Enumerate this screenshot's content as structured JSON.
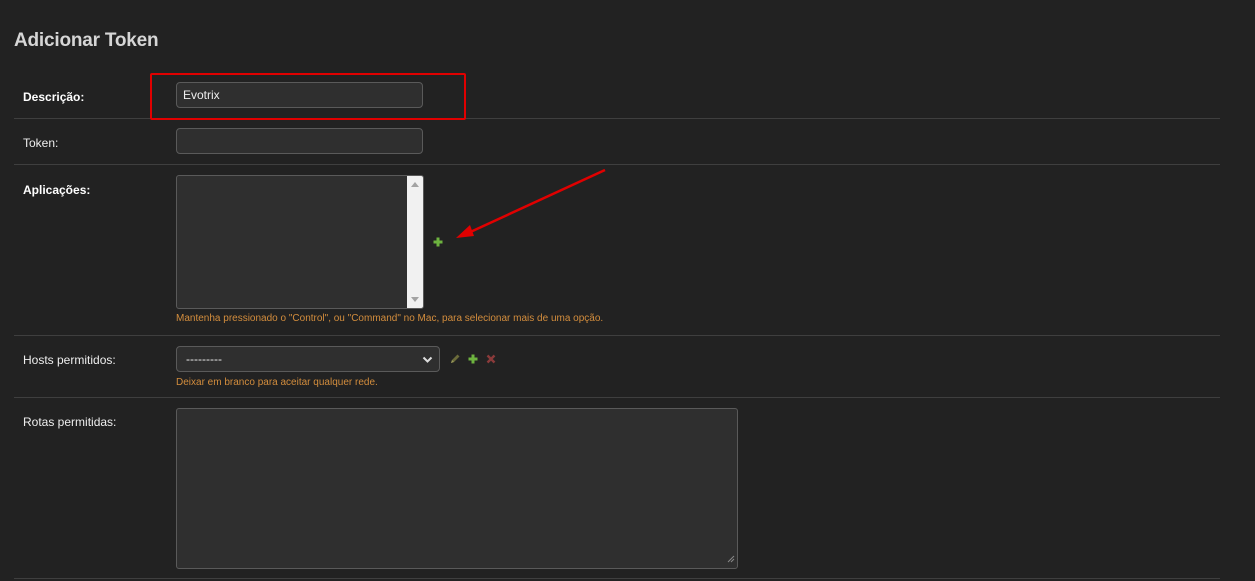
{
  "page": {
    "title": "Adicionar Token"
  },
  "fields": {
    "descricao": {
      "label": "Descrição:",
      "value": "Evotrix"
    },
    "token": {
      "label": "Token:",
      "value": ""
    },
    "aplicacoes": {
      "label": "Aplicações:",
      "help": "Mantenha pressionado o \"Control\", ou \"Command\" no Mac, para selecionar mais de uma opção.",
      "add_icon": "plus-icon"
    },
    "hosts": {
      "label": "Hosts permitidos:",
      "selected": "---------",
      "help": "Deixar em branco para aceitar qualquer rede.",
      "icons": [
        "pencil-icon",
        "plus-icon",
        "close-icon"
      ]
    },
    "rotas": {
      "label": "Rotas permitidas:",
      "value": ""
    }
  },
  "colors": {
    "background": "#222222",
    "help_text": "#d38d3d",
    "add_icon": "#6db33f",
    "delete_icon": "#a33b3b",
    "annotation": "#e00000"
  }
}
